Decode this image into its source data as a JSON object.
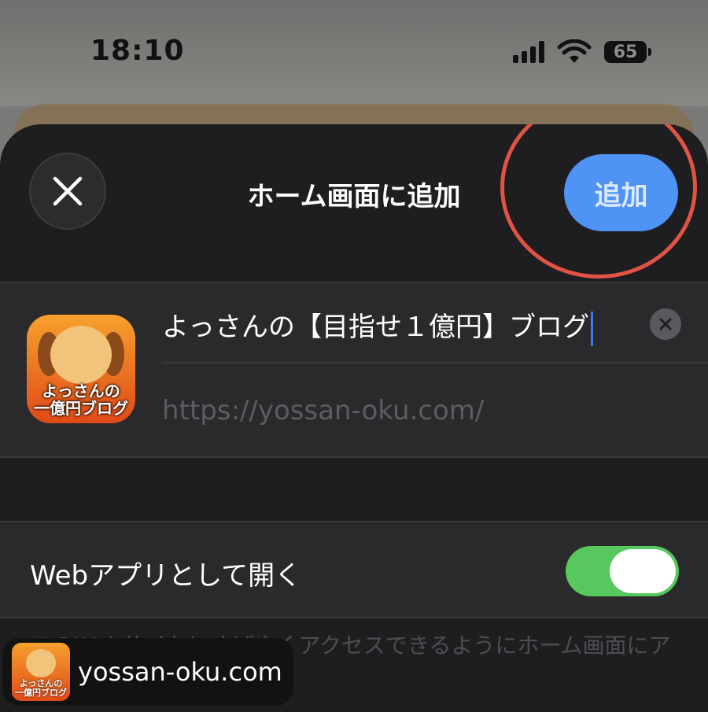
{
  "status": {
    "time": "18:10",
    "battery": "65"
  },
  "sheet": {
    "title": "ホーム画面に追加",
    "add_label": "追加",
    "app_name": "よっさんの【目指せ１億円】ブログ",
    "url": "https://yossan-oku.com/",
    "icon_text": [
      "よっさんの",
      "一億円ブログ"
    ]
  },
  "toggle": {
    "label": "Webアプリとして開く",
    "state": "on"
  },
  "footer": {
    "text": "このWebサイトにすばやくアクセスできるようにホーム画面にアイコンを追加します。"
  },
  "pill": {
    "domain": "yossan-oku.com"
  },
  "colors": {
    "accent": "#4f93f5",
    "toggle_on": "#56c85d",
    "highlight": "#e05345"
  }
}
